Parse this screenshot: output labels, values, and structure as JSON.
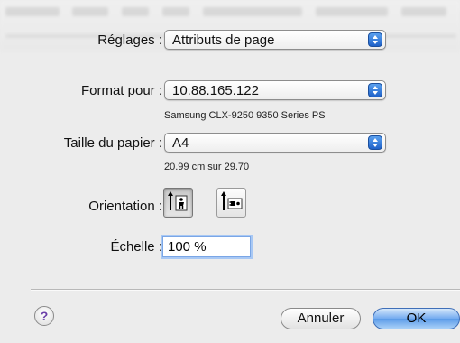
{
  "settings": {
    "label": "Réglages :",
    "value": "Attributs de page"
  },
  "format_for": {
    "label": "Format pour :",
    "value": "10.88.165.122",
    "printer_name": "Samsung CLX-9250 9350 Series PS"
  },
  "paper_size": {
    "label": "Taille du papier :",
    "value": "A4",
    "dimensions": "20.99 cm sur 29.70"
  },
  "orientation": {
    "label": "Orientation :",
    "selected": "portrait",
    "options": [
      "portrait",
      "landscape"
    ]
  },
  "scale": {
    "label": "Échelle :",
    "value": "100 %"
  },
  "buttons": {
    "help": "?",
    "cancel": "Annuler",
    "ok": "OK"
  },
  "colors": {
    "background": "#ececec",
    "accent": "#5b9be8",
    "focus_ring": "#a8c8f4"
  }
}
